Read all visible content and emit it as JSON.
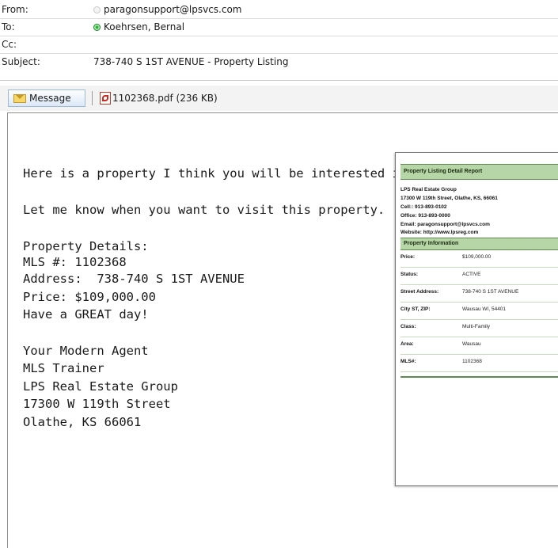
{
  "header": {
    "from_label": "From:",
    "from_value": "paragonsupport@lpsvcs.com",
    "to_label": "To:",
    "to_value": "Koehrsen, Bernal",
    "cc_label": "Cc:",
    "cc_value": "",
    "subject_label": "Subject:",
    "subject_value": "738-740 S 1ST AVENUE - Property Listing"
  },
  "attachments": {
    "message_tab": "Message",
    "file": "1102368.pdf (236 KB)"
  },
  "body": {
    "line1": "Here is a property I think you will be interested in.",
    "line2": "Let me know when you want to visit this property.",
    "details_heading": "Property Details:",
    "mls": "MLS #: 1102368",
    "address": "Address:  738-740 S 1ST AVENUE",
    "price": "Price: $109,000.00",
    "greeting": "Have a GREAT day!",
    "sig_name": "Your Modern Agent",
    "sig_title": "MLS Trainer",
    "sig_company": "LPS Real Estate Group",
    "sig_street": "17300 W 119th Street",
    "sig_city": "Olathe, KS 66061"
  },
  "preview": {
    "title": "Property Listing Detail Report",
    "company": "LPS Real Estate Group",
    "address": "17300 W 119th Street, Olathe, KS, 66061",
    "cell": "Cell:: 913-893-0102",
    "office": "Office: 913-893-0000",
    "email": "Email: paragonsupport@lpsvcs.com",
    "website": "Website: http://www.lpsreg.com",
    "section": "Property Information",
    "rows": [
      {
        "k": "Price:",
        "v": "$109,000.00"
      },
      {
        "k": "Status:",
        "v": "ACTIVE"
      },
      {
        "k": "Street Address:",
        "v": "738-740 S 1ST AVENUE"
      },
      {
        "k": "City ST, ZIP:",
        "v": "Wausau WI, 54401"
      },
      {
        "k": "Class:",
        "v": "Multi-Family"
      },
      {
        "k": "Area:",
        "v": "Wausau"
      },
      {
        "k": "MLS#:",
        "v": "1102368"
      }
    ]
  }
}
